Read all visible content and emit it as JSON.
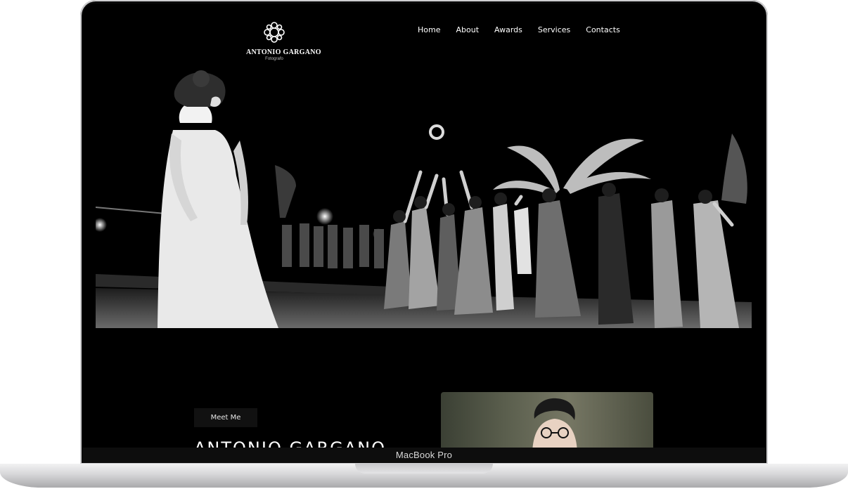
{
  "device": {
    "label": "MacBook Pro"
  },
  "site": {
    "logo": {
      "name": "ANTONIO GARGANO",
      "subtitle": "Fotografo"
    },
    "nav": [
      {
        "label": "Home"
      },
      {
        "label": "About"
      },
      {
        "label": "Awards"
      },
      {
        "label": "Services"
      },
      {
        "label": "Contacts"
      }
    ],
    "about": {
      "button_label": "Meet Me",
      "title": "ANTONIO GARGANO"
    }
  }
}
